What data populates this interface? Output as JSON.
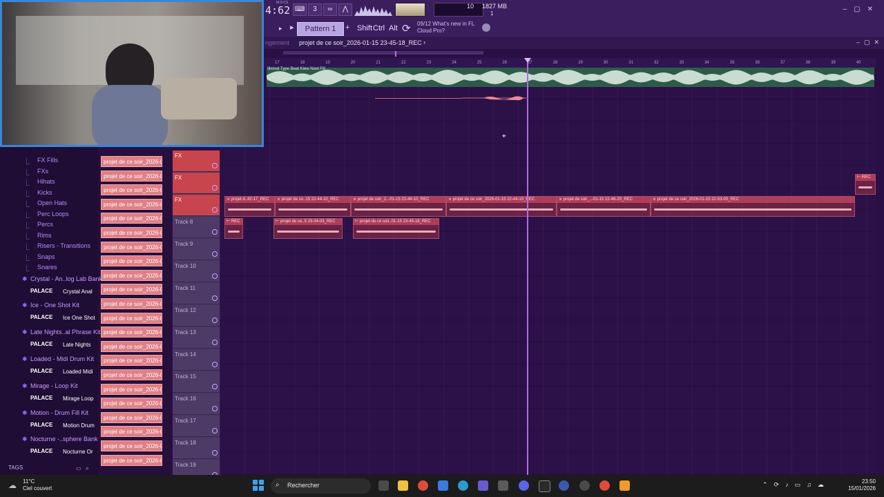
{
  "toolbar": {
    "time": "4:62",
    "time_label": "M:S:CS",
    "cpu_value": "10",
    "memory_value": "1827 MB",
    "memory_sub": "1",
    "pattern_label": "Pattern 1",
    "keys": [
      "Shift",
      "Ctrl",
      "Alt"
    ],
    "news_count": "09/12",
    "news_title": "What's new in FL",
    "news_sub": "Cloud Pro?"
  },
  "playlist": {
    "title": "projet de ce soir_2026-01-15 23-45-18_REC",
    "arrangement_label": "ngement",
    "audio_track_label": "Illmind Type Beat Kiew Next Fill",
    "ruler": [
      "17",
      "18",
      "19",
      "20",
      "21",
      "22",
      "23",
      "24",
      "25",
      "26",
      "27",
      "28",
      "29",
      "30",
      "31",
      "32",
      "33",
      "34",
      "35",
      "36",
      "37",
      "38",
      "39",
      "40"
    ]
  },
  "tracks": [
    {
      "name": "FX",
      "fx": true
    },
    {
      "name": "FX",
      "fx": true
    },
    {
      "name": "FX",
      "fx": true
    },
    {
      "name": "Track 8",
      "fx": false
    },
    {
      "name": "Track 9",
      "fx": false
    },
    {
      "name": "Track 10",
      "fx": false
    },
    {
      "name": "Track 11",
      "fx": false
    },
    {
      "name": "Track 12",
      "fx": false
    },
    {
      "name": "Track 13",
      "fx": false
    },
    {
      "name": "Track 14",
      "fx": false
    },
    {
      "name": "Track 15",
      "fx": false
    },
    {
      "name": "Track 16",
      "fx": false
    },
    {
      "name": "Track 17",
      "fx": false
    },
    {
      "name": "Track 18",
      "fx": false
    },
    {
      "name": "Track 19",
      "fx": false
    }
  ],
  "clips": [
    {
      "label": "⨯ projet d..42-17_REC",
      "track": 2,
      "start": 325,
      "end": 398
    },
    {
      "label": "⨯ projet de so..15 22-44-10_REC",
      "track": 2,
      "start": 398,
      "end": 508
    },
    {
      "label": "⨯ projet de soir_2..-01-15 22-44-10_REC",
      "track": 2,
      "start": 508,
      "end": 646
    },
    {
      "label": "⨯ projet de ce soir_2026-01-15 22-44-10_REC",
      "track": 2,
      "start": 646,
      "end": 806
    },
    {
      "label": "⨯ projet de soir_..-01-15 22-46-20_REC",
      "track": 2,
      "start": 806,
      "end": 942
    },
    {
      "label": "⨯ projet de ce soir_2026-01-15 22-53-00_REC",
      "track": 2,
      "start": 942,
      "end": 1238
    },
    {
      "label": "⊢ REC",
      "track": 3,
      "start": 325,
      "end": 352
    },
    {
      "label": "⊢ projet de ce..5 23-34-03_REC",
      "track": 3,
      "start": 396,
      "end": 496
    },
    {
      "label": "⊢ projet de ce soir..01-15 23-45-18_REC",
      "track": 3,
      "start": 511,
      "end": 636
    },
    {
      "label": "⊢ REC",
      "track": 1,
      "start": 1238,
      "end": 1268
    }
  ],
  "channels": {
    "label": "projet de ce soir_2026-0...",
    "count": 22
  },
  "browser": {
    "items": [
      {
        "label": "FX Fills",
        "type": "sub"
      },
      {
        "label": "FXs",
        "type": "sub"
      },
      {
        "label": "Hihats",
        "type": "sub"
      },
      {
        "label": "Kicks",
        "type": "sub"
      },
      {
        "label": "Open Hats",
        "type": "sub"
      },
      {
        "label": "Perc Loops",
        "type": "sub"
      },
      {
        "label": "Percs",
        "type": "sub"
      },
      {
        "label": "Rims",
        "type": "sub"
      },
      {
        "label": "Risers - Transitions",
        "type": "sub"
      },
      {
        "label": "Snaps",
        "type": "sub"
      },
      {
        "label": "Snares",
        "type": "sub"
      },
      {
        "label": "Crystal - An..log Lab Bank",
        "type": "folder"
      },
      {
        "label": "Crystal Anal",
        "type": "palace"
      },
      {
        "label": "Ice - One Shot Kit",
        "type": "folder"
      },
      {
        "label": "Ice One Shot",
        "type": "palace"
      },
      {
        "label": "Late Nights..al Phrase Kit",
        "type": "folder"
      },
      {
        "label": "Late Nights",
        "type": "palace"
      },
      {
        "label": "Loaded - Midi Drum Kit",
        "type": "folder"
      },
      {
        "label": "Loaded Midi",
        "type": "palace"
      },
      {
        "label": "Mirage - Loop Kit",
        "type": "folder"
      },
      {
        "label": "Mirage Loop",
        "type": "palace"
      },
      {
        "label": "Motion - Drum Fill Kit",
        "type": "folder"
      },
      {
        "label": "Motion Drum",
        "type": "palace"
      },
      {
        "label": "Nocturne -..sphere Bank",
        "type": "folder"
      },
      {
        "label": "Nocturne Or",
        "type": "palace"
      }
    ],
    "palace_label": "PALACE",
    "tags_label": "TAGS"
  },
  "taskbar": {
    "temperature": "11°C",
    "weather": "Ciel couvert",
    "search_placeholder": "Rechercher",
    "time": "23:50",
    "date": "15/01/2026"
  }
}
